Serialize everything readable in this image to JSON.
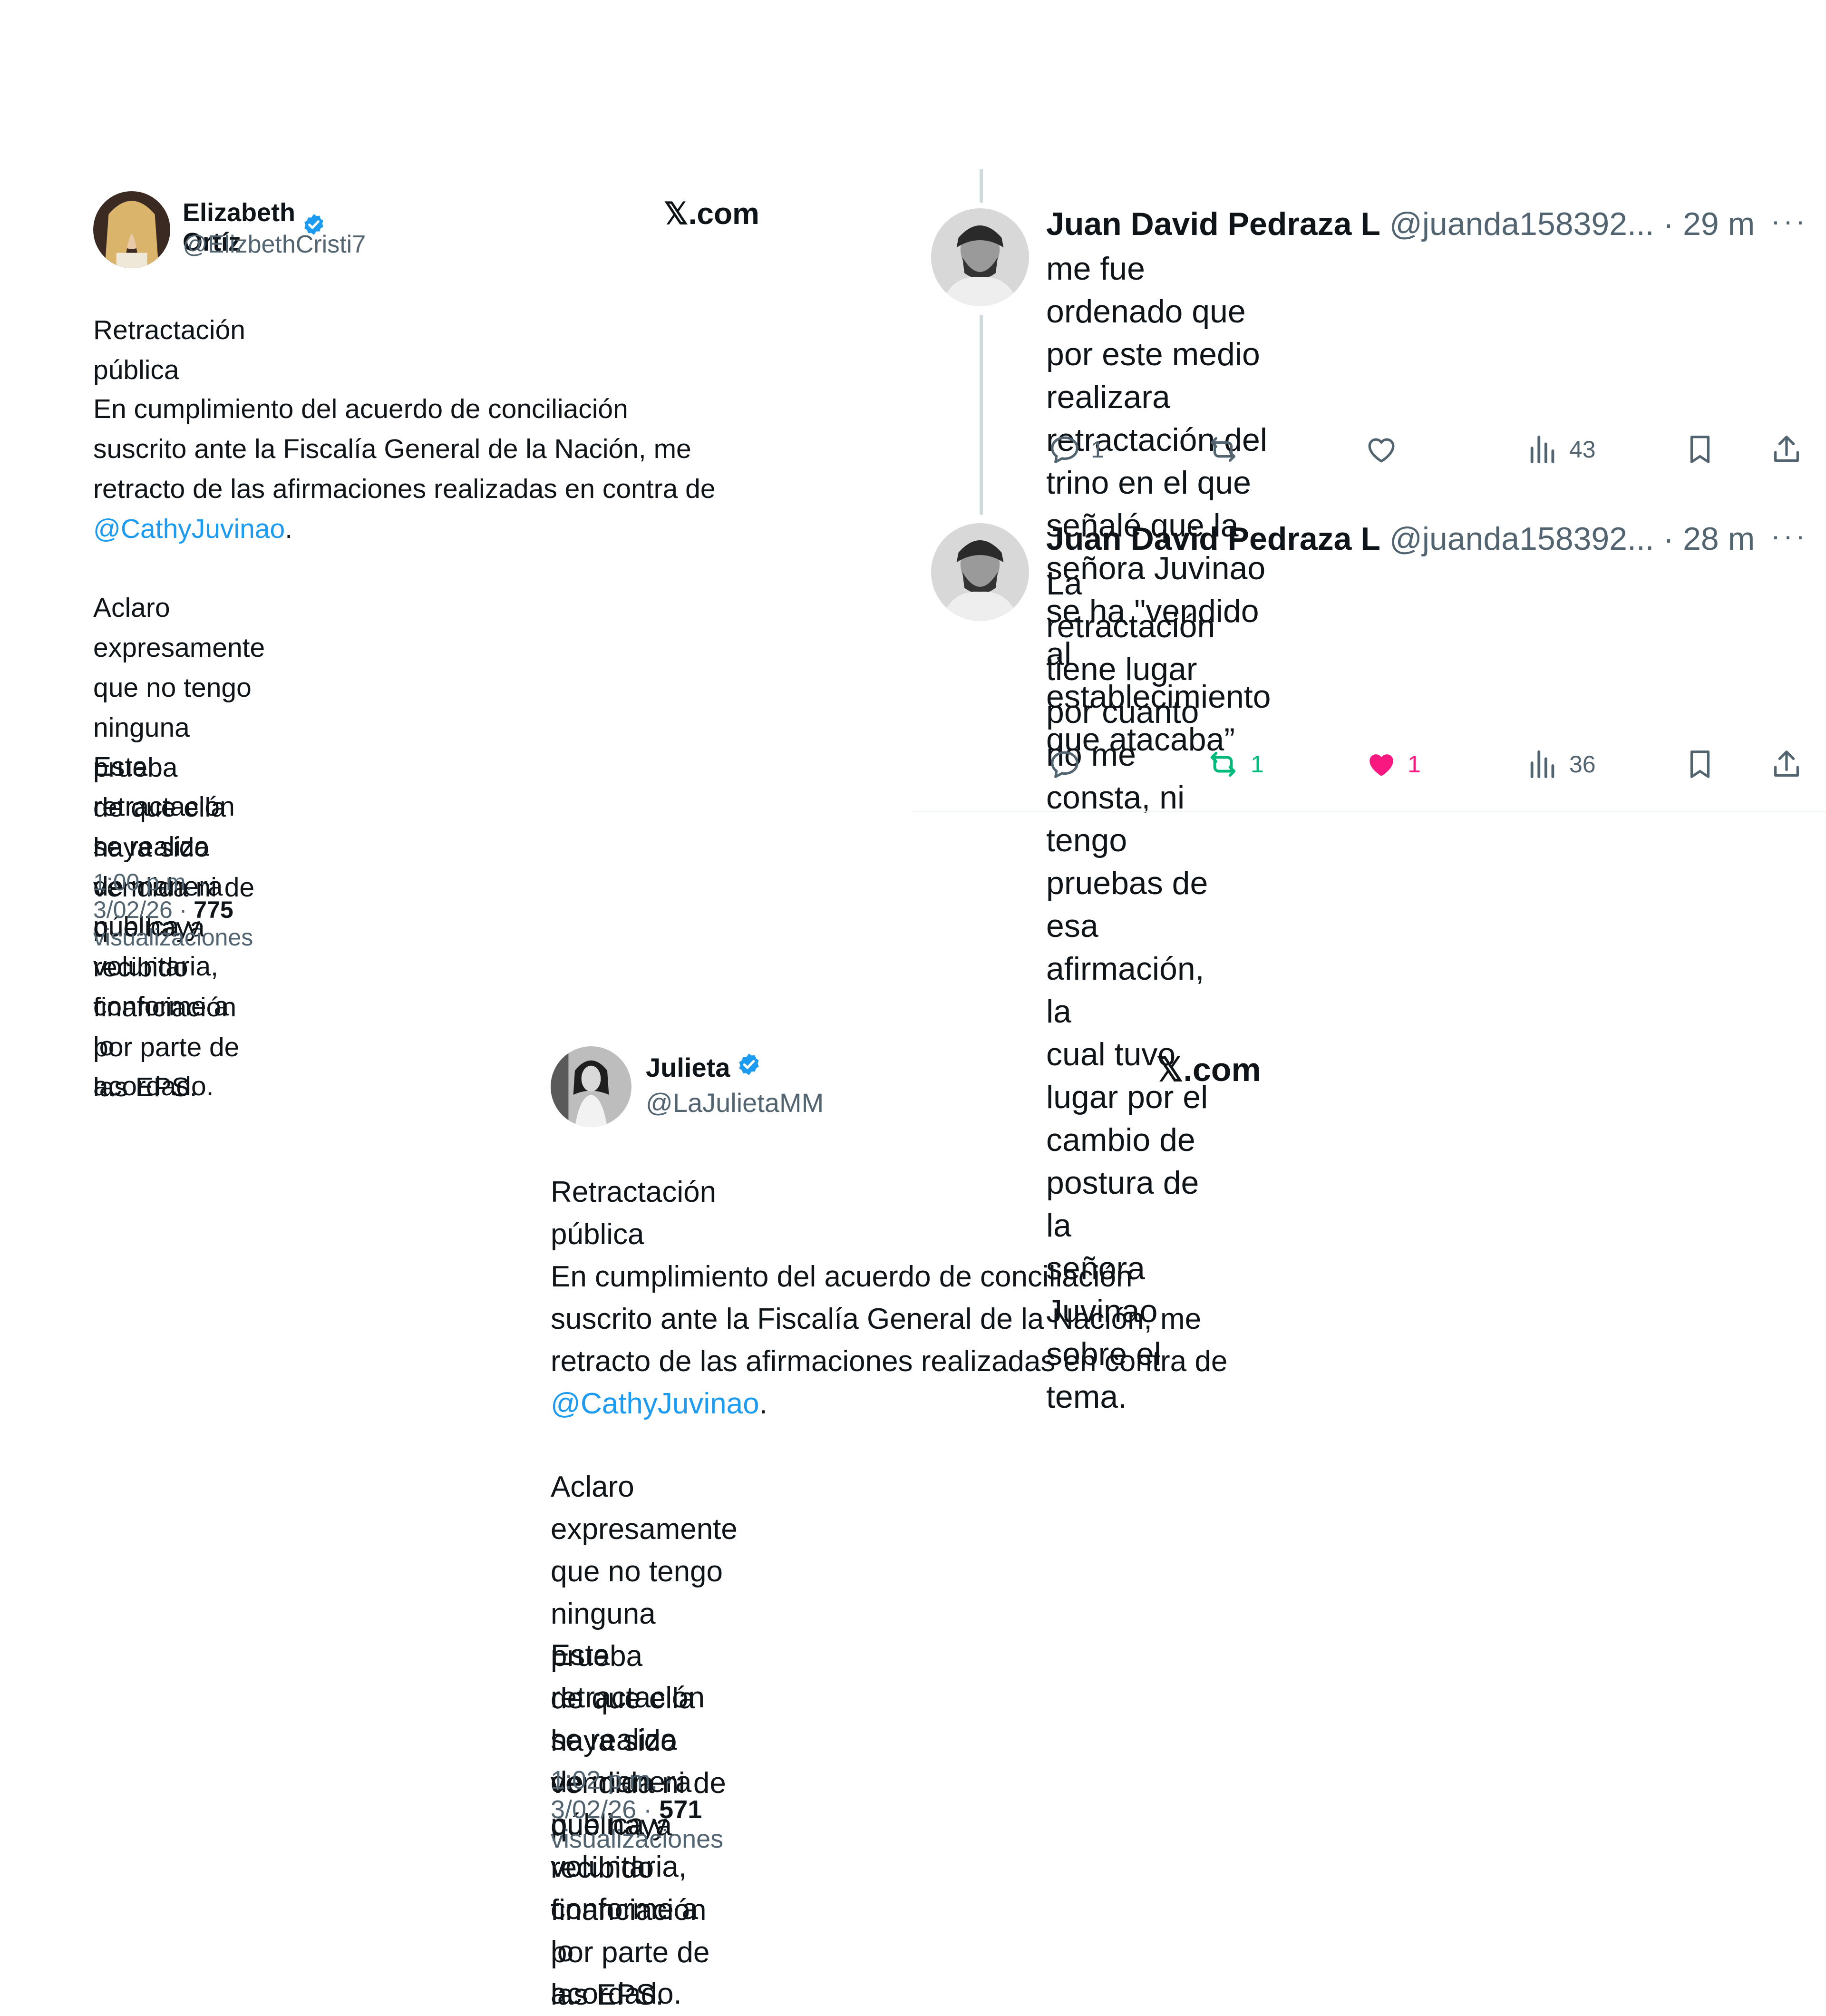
{
  "tweet1": {
    "name": "Elizabeth Ortíz",
    "handle": "@ElizbethCristi7",
    "brand": "𝕏.com",
    "title": "Retractación pública",
    "p1_text": "En cumplimiento del acuerdo de conciliación\nsuscrito ante la Fiscalía General de la Nación, me\nretracto de las afirmaciones realizadas en contra de",
    "mention": "@CathyJuvinao",
    "mention_suffix": ".",
    "p2": "Aclaro expresamente que no tengo ninguna prueba\nde que ella haya sido vendida ni de que haya\nrecibido financiación por parte de las EPS.",
    "p3": "Esta retractación se realiza de manera pública y\nvoluntaria, conforme a lo acordado.",
    "meta_time": "1:00 p.m. · 3/02/26 · ",
    "meta_views": "775",
    "meta_views_label": " visualizaciones"
  },
  "thread": {
    "reply1": {
      "name": "Juan David Pedraza L",
      "handle": "@juanda158392...",
      "time": " · 29 m",
      "more": "···",
      "text": "me fue ordenado que por este medio realizara\nretractación del trino en el que señalé que la\nseñora Juvinao se ha \"vendido al establecimiento\nque atacaba”",
      "replies": "1",
      "retweets": "",
      "likes": "",
      "views": "43"
    },
    "reply2": {
      "name": "Juan David Pedraza L",
      "handle": "@juanda158392...",
      "time": " · 28 m",
      "more": "···",
      "text": "La retractación tiene lugar por cuanto no me\nconsta, ni tengo pruebas de esa afirmación, la\ncual tuvo lugar por el cambio de postura de la\nseñora Juvinao sobre el tema.",
      "replies": "",
      "retweets": "1",
      "likes": "1",
      "views": "36"
    }
  },
  "tweet2": {
    "name": "Julieta",
    "handle": "@LaJulietaMM",
    "brand": "𝕏.com",
    "title": "Retractación pública",
    "p1_text": "En cumplimiento del acuerdo de conciliación\nsuscrito ante la Fiscalía General de la Nación, me\nretracto de las afirmaciones realizadas en contra de",
    "mention": "@CathyJuvinao",
    "mention_suffix": ".",
    "p2": "Aclaro expresamente que no tengo ninguna prueba\nde que ella haya sido vendida ni de que haya\nrecibido financiación por parte de las EPS.",
    "p3": "Esta retractación se realiza de manera pública y\nvoluntaria, conforme a lo acordado.",
    "meta_time": "1:02 p.m. · 3/02/26 · ",
    "meta_views": "571",
    "meta_views_label": " visualizaciones"
  },
  "colors": {
    "text": "#0f1419",
    "secondary": "#536471",
    "link": "#1d9bf0",
    "retweet_active": "#00ba7c",
    "like_active": "#f91880",
    "verified": "#1d9bf0"
  }
}
